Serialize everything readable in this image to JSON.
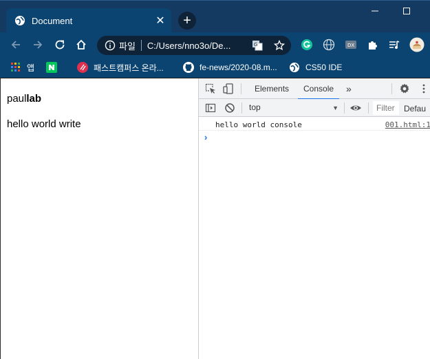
{
  "browser": {
    "tab": {
      "title": "Document",
      "close_glyph": "✕",
      "favicon": "globe-icon"
    },
    "new_tab_glyph": "+",
    "window_controls": {
      "minimize_glyph": "—",
      "maximize_glyph": "☐"
    },
    "omnibox": {
      "chip": "파일",
      "url": "C:/Users/nno3o/De..."
    },
    "bookmarks": [
      {
        "label": "앱",
        "icon": "apps-grid-icon"
      },
      {
        "label": "",
        "icon": "naver-icon"
      },
      {
        "label": "패스트캠퍼스 온라...",
        "icon": "fastcampus-icon"
      },
      {
        "label": "fe-news/2020-08.m...",
        "icon": "github-icon"
      },
      {
        "label": "CS50 IDE",
        "icon": "globe-icon"
      }
    ]
  },
  "page": {
    "line1_normal": "paul",
    "line1_bold": "lab",
    "line2": "hello world write"
  },
  "devtools": {
    "tabs": [
      "Elements",
      "Console"
    ],
    "active_tab": "Console",
    "more_glyph": "»",
    "context": "top",
    "filter_placeholder": "Filter",
    "levels": "Defau",
    "console": {
      "message": "hello world console",
      "source": "001.html:1",
      "prompt_glyph": "›"
    }
  },
  "colors": {
    "frame": "#143a61",
    "toolbar": "#0b4470",
    "omnibox": "#0e2238",
    "accent": "#1a73e8"
  }
}
